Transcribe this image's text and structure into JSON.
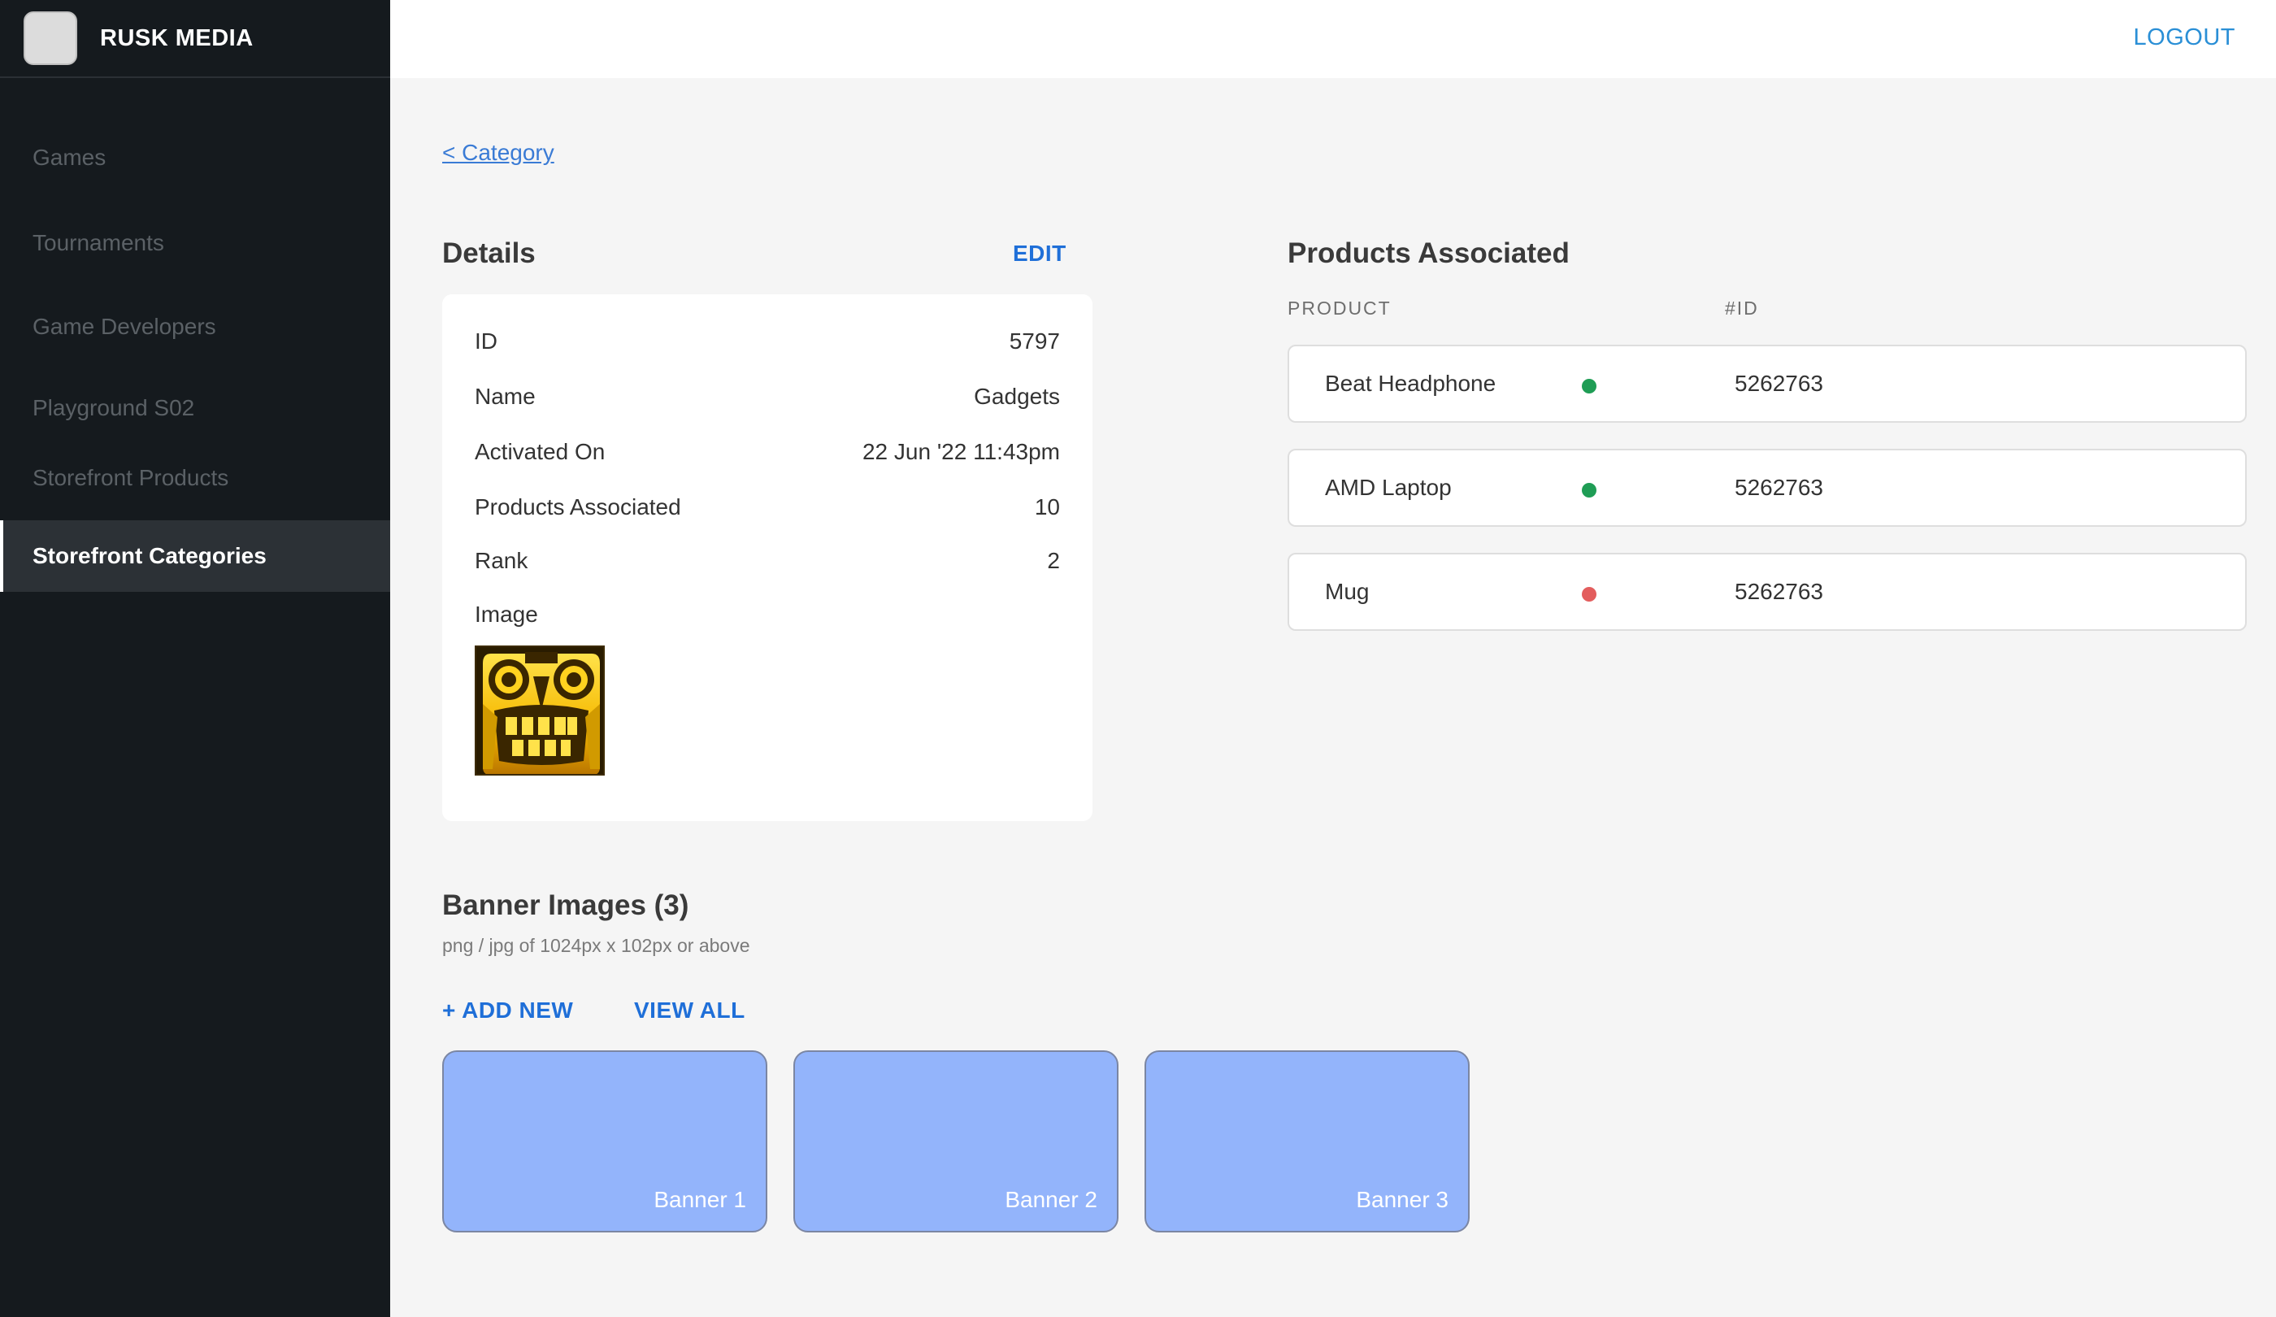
{
  "brand": {
    "name": "RUSK MEDIA"
  },
  "topbar": {
    "logout_label": "LOGOUT"
  },
  "sidebar": {
    "items": [
      {
        "label": "Games"
      },
      {
        "label": "Tournaments"
      },
      {
        "label": "Game Developers"
      },
      {
        "label": "Playground S02"
      },
      {
        "label": "Storefront Products"
      },
      {
        "label": "Storefront Categories",
        "active": true
      }
    ]
  },
  "breadcrumb": {
    "back_label": "< Category"
  },
  "details": {
    "title": "Details",
    "edit_label": "EDIT",
    "rows": [
      {
        "label": "ID",
        "value": "5797"
      },
      {
        "label": "Name",
        "value": "Gadgets"
      },
      {
        "label": "Activated On",
        "value": "22 Jun '22 11:43pm"
      },
      {
        "label": "Products Associated",
        "value": "10"
      },
      {
        "label": "Rank",
        "value": "2"
      }
    ],
    "image_label": "Image"
  },
  "products": {
    "title": "Products Associated",
    "columns": [
      "PRODUCT",
      "#ID"
    ],
    "rows": [
      {
        "name": "Beat Headphone",
        "status": "active",
        "id": "5262763"
      },
      {
        "name": "AMD Laptop",
        "status": "active",
        "id": "5262763"
      },
      {
        "name": "Mug",
        "status": "inactive",
        "id": "5262763"
      }
    ]
  },
  "banners": {
    "title": "Banner Images (3)",
    "subtitle": "png / jpg of 1024px x 102px or above",
    "add_label": "+ ADD NEW",
    "view_all_label": "VIEW ALL",
    "items": [
      {
        "label": "Banner 1"
      },
      {
        "label": "Banner 2"
      },
      {
        "label": "Banner 3"
      }
    ]
  },
  "colors": {
    "accent": "#1f6fd8",
    "status_active": "#1f9d55",
    "status_inactive": "#e35d5d",
    "banner_fill": "#93b4fb",
    "sidebar_bg": "#151a1e"
  }
}
